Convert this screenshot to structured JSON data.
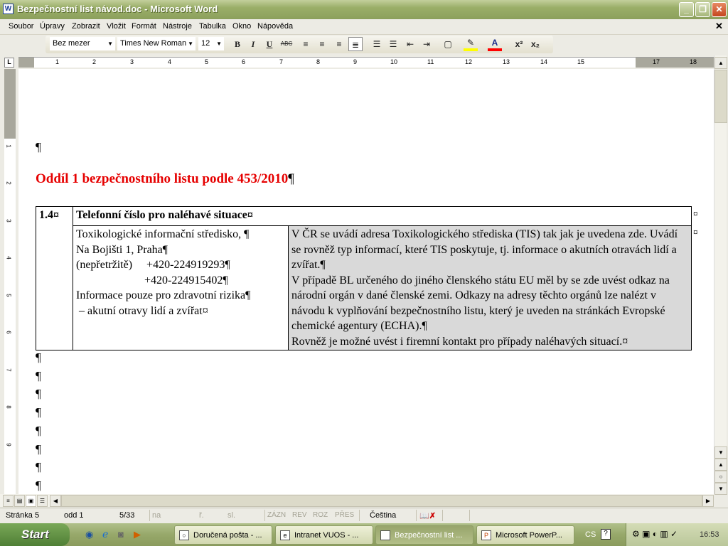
{
  "window": {
    "title": "Bezpečnostní list návod.doc - Microsoft Word",
    "app_icon": "W"
  },
  "menu": [
    "Soubor",
    "Úpravy",
    "Zobrazit",
    "Vložit",
    "Formát",
    "Nástroje",
    "Tabulka",
    "Okno",
    "Nápověda"
  ],
  "toolbar": {
    "style": "Bez mezer",
    "font": "Times New Roman",
    "size": "12",
    "bold": "B",
    "italic": "I",
    "underline": "U",
    "strike": "ABC",
    "highlight_color": "#ffff00",
    "font_color": "#ff0000"
  },
  "ruler": {
    "numbers": [
      "1",
      "2",
      "3",
      "4",
      "5",
      "6",
      "7",
      "8",
      "9",
      "10",
      "11",
      "12",
      "13",
      "14",
      "15",
      "17",
      "18"
    ]
  },
  "document": {
    "pilcrow": "¶",
    "heading": "Oddíl 1 bezpečnostního listu podle 453/2010",
    "heading_color": "#e60000",
    "table": {
      "num": "1.4¤",
      "title": "Telefonní číslo pro naléhavé situace¤",
      "left_lines": [
        "Toxikologické informační středisko, ¶",
        "Na Bojišti 1, Praha¶",
        "(nepřetržitě)     +420-224919293¶",
        "                        +420-224915402¶",
        "Informace pouze pro zdravotní rizika¶",
        " – akutní otravy lidí a zvířat¤"
      ],
      "right_paragraphs": [
        "V ČR se uvádí adresa Toxikologického střediska (TIS) tak jak je uvedena zde. Uvádí se rovněž typ informací, které TIS poskytuje, tj. informace o akutních otravách lidí a zvířat.¶",
        "V případě BL určeného do jiného členského státu EU měl by se zde uvést odkaz na národní orgán v dané členské zemi. Odkazy na adresy těchto orgánů lze nalézt v návodu k vyplňování bezpečnostního listu, který je uveden na stránkách Evropské chemické agentury (ECHA).¶",
        "Rovněž je možné uvést i firemní kontakt pro případy naléhavých situací.¤"
      ],
      "end_mark": "¤"
    }
  },
  "status": {
    "page": "Stránka 5",
    "section": "odd 1",
    "pages": "5/33",
    "at": "na",
    "line": "ř.",
    "col": "sl.",
    "rec": "ZÁZN",
    "trk": "REV",
    "ext": "ROZ",
    "ovr": "PŘES",
    "language": "Čeština"
  },
  "taskbar": {
    "start": "Start",
    "tasks": [
      "Doručená pošta - ...",
      "Intranet VUOS - ...",
      "Bezpečnostní list ...",
      "Microsoft PowerP..."
    ],
    "lang": "CS",
    "clock": "16:53"
  }
}
